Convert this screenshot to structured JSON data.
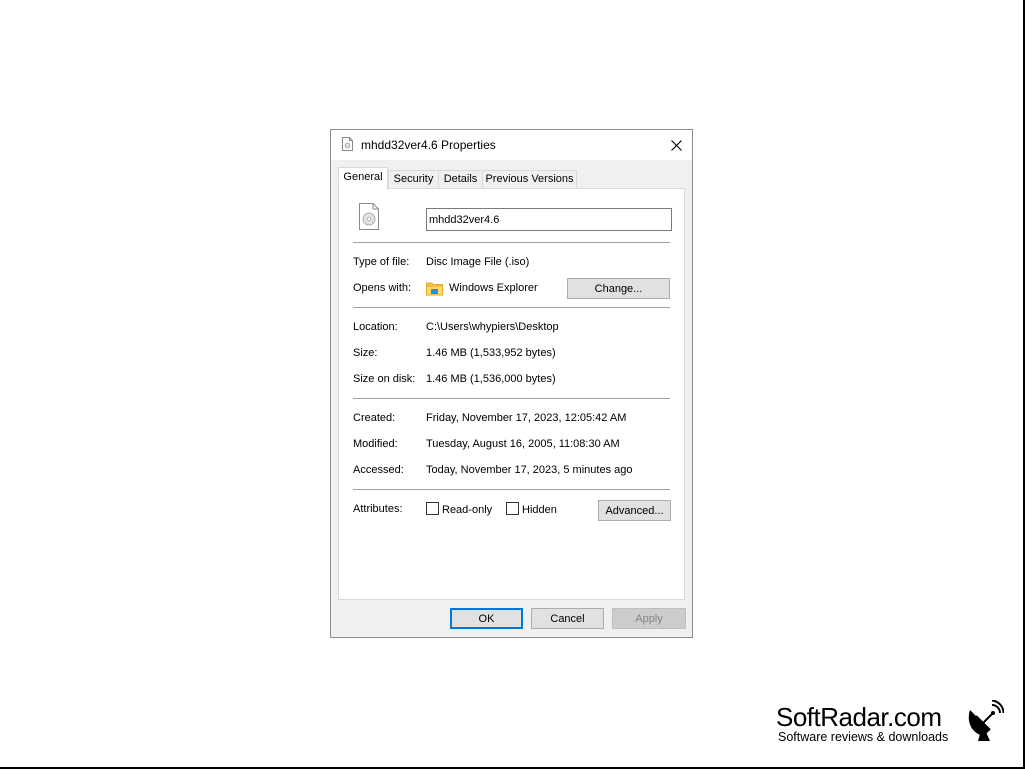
{
  "dialog": {
    "title": "mhdd32ver4.6 Properties",
    "close_glyph": "✕",
    "tabs": [
      {
        "label": "General",
        "active": true
      },
      {
        "label": "Security",
        "active": false
      },
      {
        "label": "Details",
        "active": false
      },
      {
        "label": "Previous Versions",
        "active": false
      }
    ],
    "file_name": "mhdd32ver4.6",
    "type_of_file": {
      "label": "Type of file:",
      "value": "Disc Image File (.iso)"
    },
    "opens_with": {
      "label": "Opens with:",
      "value": "Windows Explorer",
      "icon": "folder-icon",
      "button": "Change..."
    },
    "location": {
      "label": "Location:",
      "value": "C:\\Users\\whypiers\\Desktop"
    },
    "size": {
      "label": "Size:",
      "value": "1.46 MB (1,533,952 bytes)"
    },
    "size_on_disk": {
      "label": "Size on disk:",
      "value": "1.46 MB (1,536,000 bytes)"
    },
    "created": {
      "label": "Created:",
      "value": "Friday, November 17, 2023, 12:05:42 AM"
    },
    "modified": {
      "label": "Modified:",
      "value": "Tuesday, August 16, 2005, 11:08:30 AM"
    },
    "accessed": {
      "label": "Accessed:",
      "value": "Today, November 17, 2023, 5 minutes ago"
    },
    "attributes": {
      "label": "Attributes:",
      "read_only": {
        "label": "Read-only",
        "checked": false
      },
      "hidden": {
        "label": "Hidden",
        "checked": false
      },
      "advanced_button": "Advanced..."
    },
    "buttons": {
      "ok": "OK",
      "cancel": "Cancel",
      "apply": "Apply"
    }
  },
  "watermark": {
    "title": "SoftRadar.com",
    "subtitle": "Software reviews & downloads",
    "icon": "satellite-dish-icon"
  },
  "colors": {
    "dialog_bg": "#f0f0f0",
    "accent": "#0078d7",
    "button_bg": "#e1e1e1"
  }
}
